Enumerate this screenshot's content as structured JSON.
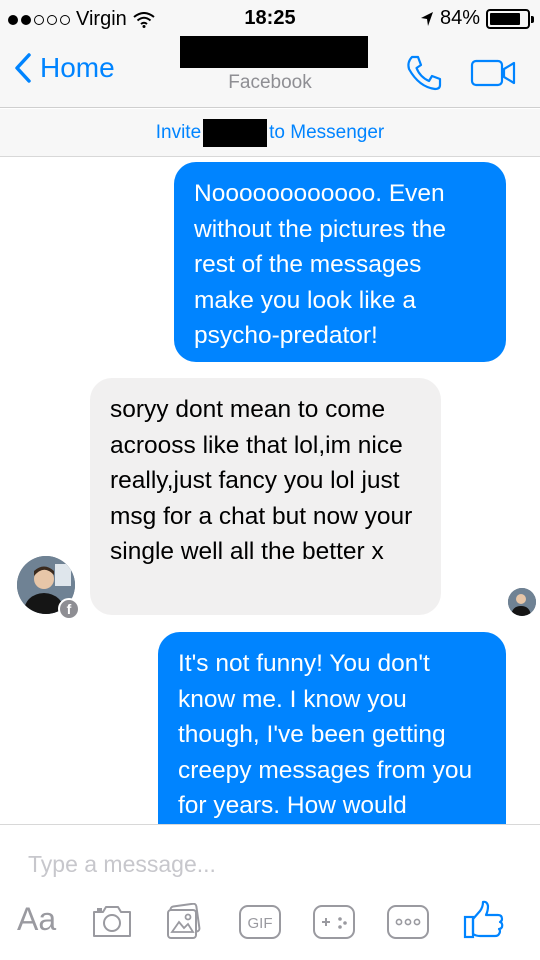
{
  "status_bar": {
    "carrier": "Virgin",
    "time": "18:25",
    "battery": "84%",
    "battery_level": 0.84
  },
  "nav": {
    "back_label": "Home",
    "contact_name": "",
    "subtitle": "Facebook",
    "icons": [
      "back-chevron-icon",
      "phone-icon",
      "video-camera-icon"
    ]
  },
  "invite": {
    "prefix": "Invite",
    "suffix": "to Messenger"
  },
  "messages": [
    {
      "direction": "outgoing",
      "text": "Noooooooooooo. Even without the pictures the rest of the messages make you look like a psycho-predator!"
    },
    {
      "direction": "incoming",
      "text": "soryy dont mean to come acrooss like that lol,im nice really,just fancy you lol just msg for a chat but now your single well all the better x"
    },
    {
      "direction": "outgoing",
      "text": "It's not funny! You don't know me. I know you though, I've been getting creepy messages from you for years. How would"
    }
  ],
  "composer": {
    "placeholder": "Type a message...",
    "aa_label": "Aa",
    "gif_label": "GIF",
    "icons": [
      "camera-icon",
      "gallery-icon",
      "gif-icon",
      "games-icon",
      "more-icon",
      "thumbs-up-icon"
    ]
  },
  "colors": {
    "accent": "#0084ff",
    "incoming_bubble": "#f1f0f0",
    "bar_background": "#f7f7f7",
    "muted": "#8e8e93"
  }
}
